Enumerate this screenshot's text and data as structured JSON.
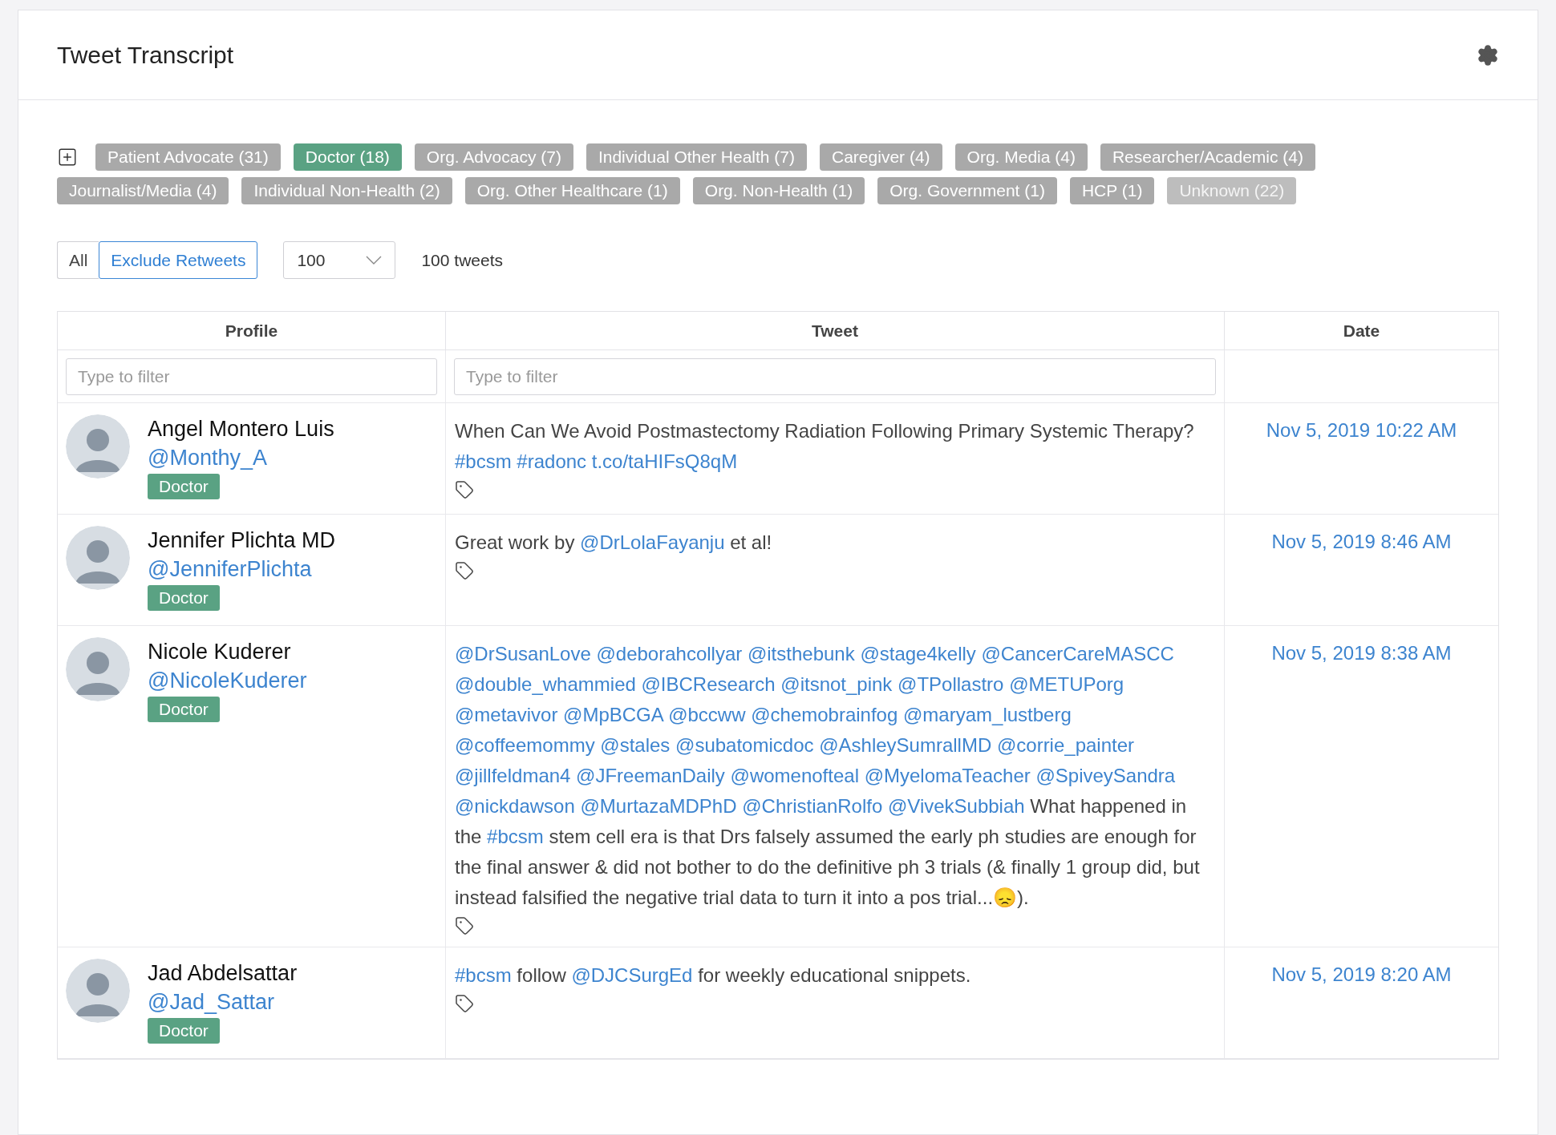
{
  "title": "Tweet Transcript",
  "tags": [
    {
      "label": "Patient Advocate (31)",
      "selected": false,
      "faded": false
    },
    {
      "label": "Doctor (18)",
      "selected": true,
      "faded": false
    },
    {
      "label": "Org. Advocacy (7)",
      "selected": false,
      "faded": false
    },
    {
      "label": "Individual Other Health (7)",
      "selected": false,
      "faded": false
    },
    {
      "label": "Caregiver (4)",
      "selected": false,
      "faded": false
    },
    {
      "label": "Org. Media (4)",
      "selected": false,
      "faded": false
    },
    {
      "label": "Researcher/Academic (4)",
      "selected": false,
      "faded": false
    },
    {
      "label": "Journalist/Media (4)",
      "selected": false,
      "faded": false
    },
    {
      "label": "Individual Non-Health (2)",
      "selected": false,
      "faded": false
    },
    {
      "label": "Org. Other Healthcare (1)",
      "selected": false,
      "faded": false
    },
    {
      "label": "Org. Non-Health (1)",
      "selected": false,
      "faded": false
    },
    {
      "label": "Org. Government (1)",
      "selected": false,
      "faded": false
    },
    {
      "label": "HCP (1)",
      "selected": false,
      "faded": false
    },
    {
      "label": "Unknown (22)",
      "selected": false,
      "faded": true
    }
  ],
  "retweet_filter": [
    {
      "label": "All",
      "selected": false
    },
    {
      "label": "Exclude Retweets",
      "selected": true
    }
  ],
  "page_size": "100",
  "count": "100 tweets",
  "table": {
    "columns": [
      "Profile",
      "Tweet",
      "Date"
    ],
    "filters": [
      {
        "placeholder": "Type to filter"
      },
      {
        "placeholder": "Type to filter"
      }
    ],
    "rows": [
      {
        "name": "Angel Montero Luis",
        "handle": "@Monthy_A",
        "role": "Doctor",
        "date": "Nov 5, 2019 10:22 AM",
        "tweet": [
          {
            "text": "When Can We Avoid Postmastectomy Radiation Following Primary Systemic Therapy?",
            "link": false
          },
          {
            "text": "#bcsm",
            "link": true
          },
          {
            "text": "#radonc",
            "link": true
          },
          {
            "text": "t.co/taHIFsQ8qM",
            "link": true
          }
        ]
      },
      {
        "name": "Jennifer Plichta MD",
        "handle": "@JenniferPlichta",
        "role": "Doctor",
        "date": "Nov 5, 2019 8:46 AM",
        "tweet": [
          {
            "text": "Great work by",
            "link": false
          },
          {
            "text": "@DrLolaFayanju",
            "link": true
          },
          {
            "text": "et al!",
            "link": false
          }
        ]
      },
      {
        "name": "Nicole Kuderer",
        "handle": "@NicoleKuderer",
        "role": "Doctor",
        "date": "Nov 5, 2019 8:38 AM",
        "tweet": [
          {
            "text": "@DrSusanLove",
            "link": true
          },
          {
            "text": "@deborahcollyar",
            "link": true
          },
          {
            "text": "@itsthebunk",
            "link": true
          },
          {
            "text": "@stage4kelly",
            "link": true
          },
          {
            "text": "@CancerCareMASCC",
            "link": true
          },
          {
            "text": "@double_whammied",
            "link": true
          },
          {
            "text": "@IBCResearch",
            "link": true
          },
          {
            "text": "@itsnot_pink",
            "link": true
          },
          {
            "text": "@TPollastro",
            "link": true
          },
          {
            "text": "@METUPorg",
            "link": true
          },
          {
            "text": "@metavivor",
            "link": true
          },
          {
            "text": "@MpBCGA",
            "link": true
          },
          {
            "text": "@bccww",
            "link": true
          },
          {
            "text": "@chemobrainfog",
            "link": true
          },
          {
            "text": "@maryam_lustberg",
            "link": true
          },
          {
            "text": "@coffeemommy",
            "link": true
          },
          {
            "text": "@stales",
            "link": true
          },
          {
            "text": "@subatomicdoc",
            "link": true
          },
          {
            "text": "@AshleySumrallMD",
            "link": true
          },
          {
            "text": "@corrie_painter",
            "link": true
          },
          {
            "text": "@jillfeldman4",
            "link": true
          },
          {
            "text": "@JFreemanDaily",
            "link": true
          },
          {
            "text": "@womenofteal",
            "link": true
          },
          {
            "text": "@MyelomaTeacher",
            "link": true
          },
          {
            "text": "@SpiveySandra",
            "link": true
          },
          {
            "text": "@nickdawson",
            "link": true
          },
          {
            "text": "@MurtazaMDPhD",
            "link": true
          },
          {
            "text": "@ChristianRolfo",
            "link": true
          },
          {
            "text": "@VivekSubbiah",
            "link": true
          },
          {
            "text": "What happened in the",
            "link": false
          },
          {
            "text": "#bcsm",
            "link": true
          },
          {
            "text": "stem cell era is that Drs falsely assumed the early ph studies are enough for the final answer & did not bother to do the definitive ph 3 trials (& finally 1 group did, but instead falsified the negative trial data to turn it into a pos trial...😞).",
            "link": false
          }
        ]
      },
      {
        "name": "Jad Abdelsattar",
        "handle": "@Jad_Sattar",
        "role": "Doctor",
        "date": "Nov 5, 2019 8:20 AM",
        "tweet": [
          {
            "text": "#bcsm",
            "link": true
          },
          {
            "text": "follow",
            "link": false
          },
          {
            "text": "@DJCSurgEd",
            "link": true
          },
          {
            "text": "for weekly educational snippets.",
            "link": false
          }
        ]
      }
    ]
  }
}
